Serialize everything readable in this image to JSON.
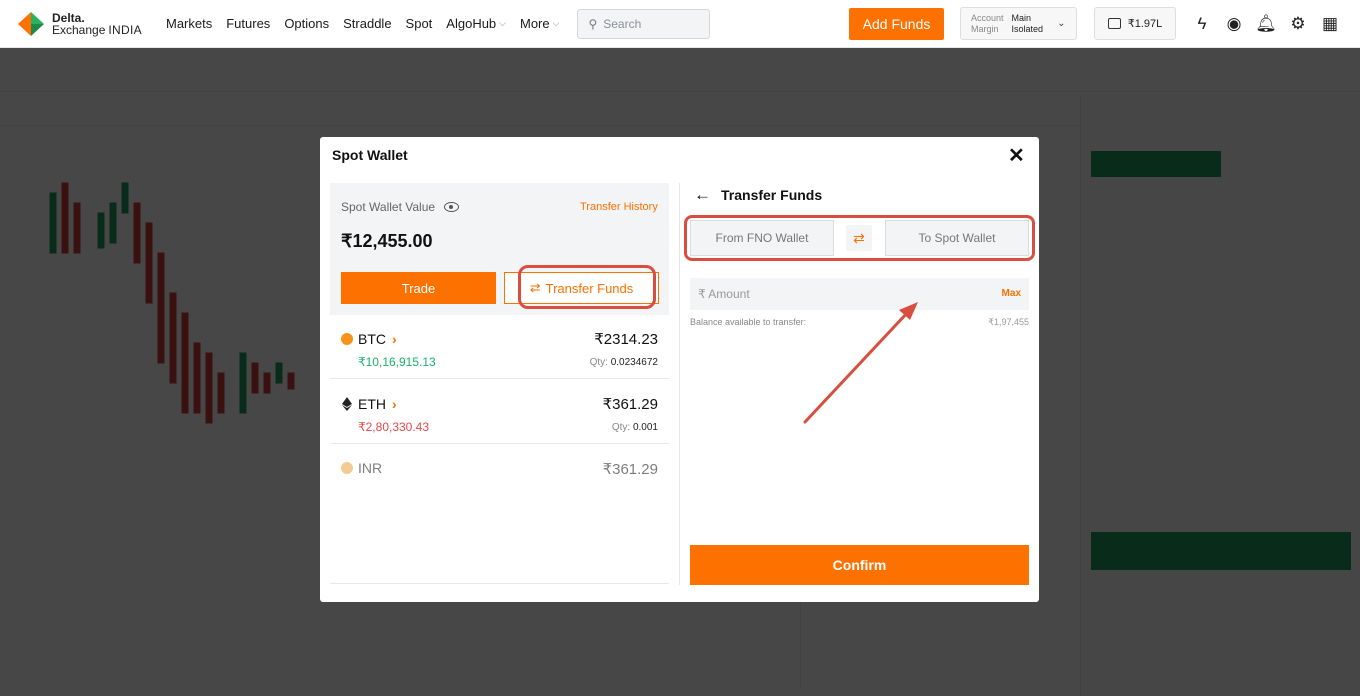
{
  "brand": {
    "line1": "Delta.",
    "line2": "Exchange",
    "region": "INDIA"
  },
  "nav": {
    "links": [
      {
        "label": "Markets"
      },
      {
        "label": "Futures"
      },
      {
        "label": "Options"
      },
      {
        "label": "Straddle"
      },
      {
        "label": "Spot"
      },
      {
        "label": "AlgoHub",
        "dropdown": true
      },
      {
        "label": "More",
        "dropdown": true
      }
    ],
    "search_placeholder": "Search",
    "add_funds": "Add Funds",
    "account": {
      "account_label": "Account",
      "margin_label": "Margin",
      "account_value": "Main",
      "margin_value": "Isolated"
    },
    "wallet_balance": "₹1.97L"
  },
  "modal": {
    "title": "Spot Wallet",
    "summary": {
      "label": "Spot Wallet Value",
      "transfer_history": "Transfer History",
      "value": "₹12,455.00",
      "trade_button": "Trade",
      "transfer_button": "Transfer Funds"
    },
    "assets": [
      {
        "symbol": "BTC",
        "inr_value": "₹10,16,915.13",
        "inr_color": "#17b26a",
        "value": "₹2314.23",
        "qty_label": "Qty:",
        "qty": "0.0234672"
      },
      {
        "symbol": "ETH",
        "inr_value": "₹2,80,330.43",
        "inr_color": "#e5484d",
        "value": "₹361.29",
        "qty_label": "Qty:",
        "qty": "0.001"
      },
      {
        "symbol": "INR",
        "value": "₹361.29"
      }
    ],
    "transfer": {
      "title": "Transfer Funds",
      "from": "From FNO Wallet",
      "to": "To Spot Wallet",
      "amount_placeholder": "₹ Amount",
      "max": "Max",
      "balance_label": "Balance available to transfer:",
      "balance_value": "₹1,97,455",
      "confirm": "Confirm"
    }
  },
  "colors": {
    "accent": "#fd7100",
    "highlight": "#d84f3f",
    "positive": "#17b26a",
    "negative": "#e5484d"
  }
}
